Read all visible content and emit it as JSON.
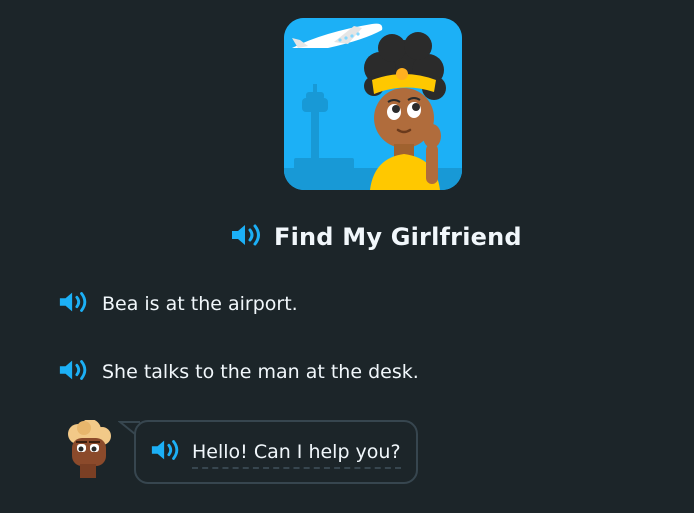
{
  "story": {
    "title": "Find My Girlfriend",
    "image_alt": "Bea at the airport illustration"
  },
  "lines": [
    {
      "text": "Bea is at the airport."
    },
    {
      "text": "She talks to the man at the desk."
    }
  ],
  "dialogue": {
    "speaker_avatar": "man-character-avatar",
    "text": "Hello! Can I help you?"
  },
  "colors": {
    "background": "#1c2529",
    "text": "#f1f7fb",
    "accent_blue": "#1cb0f6",
    "bubble_border": "#37464f"
  },
  "icons": {
    "speaker": "speaker-icon"
  }
}
